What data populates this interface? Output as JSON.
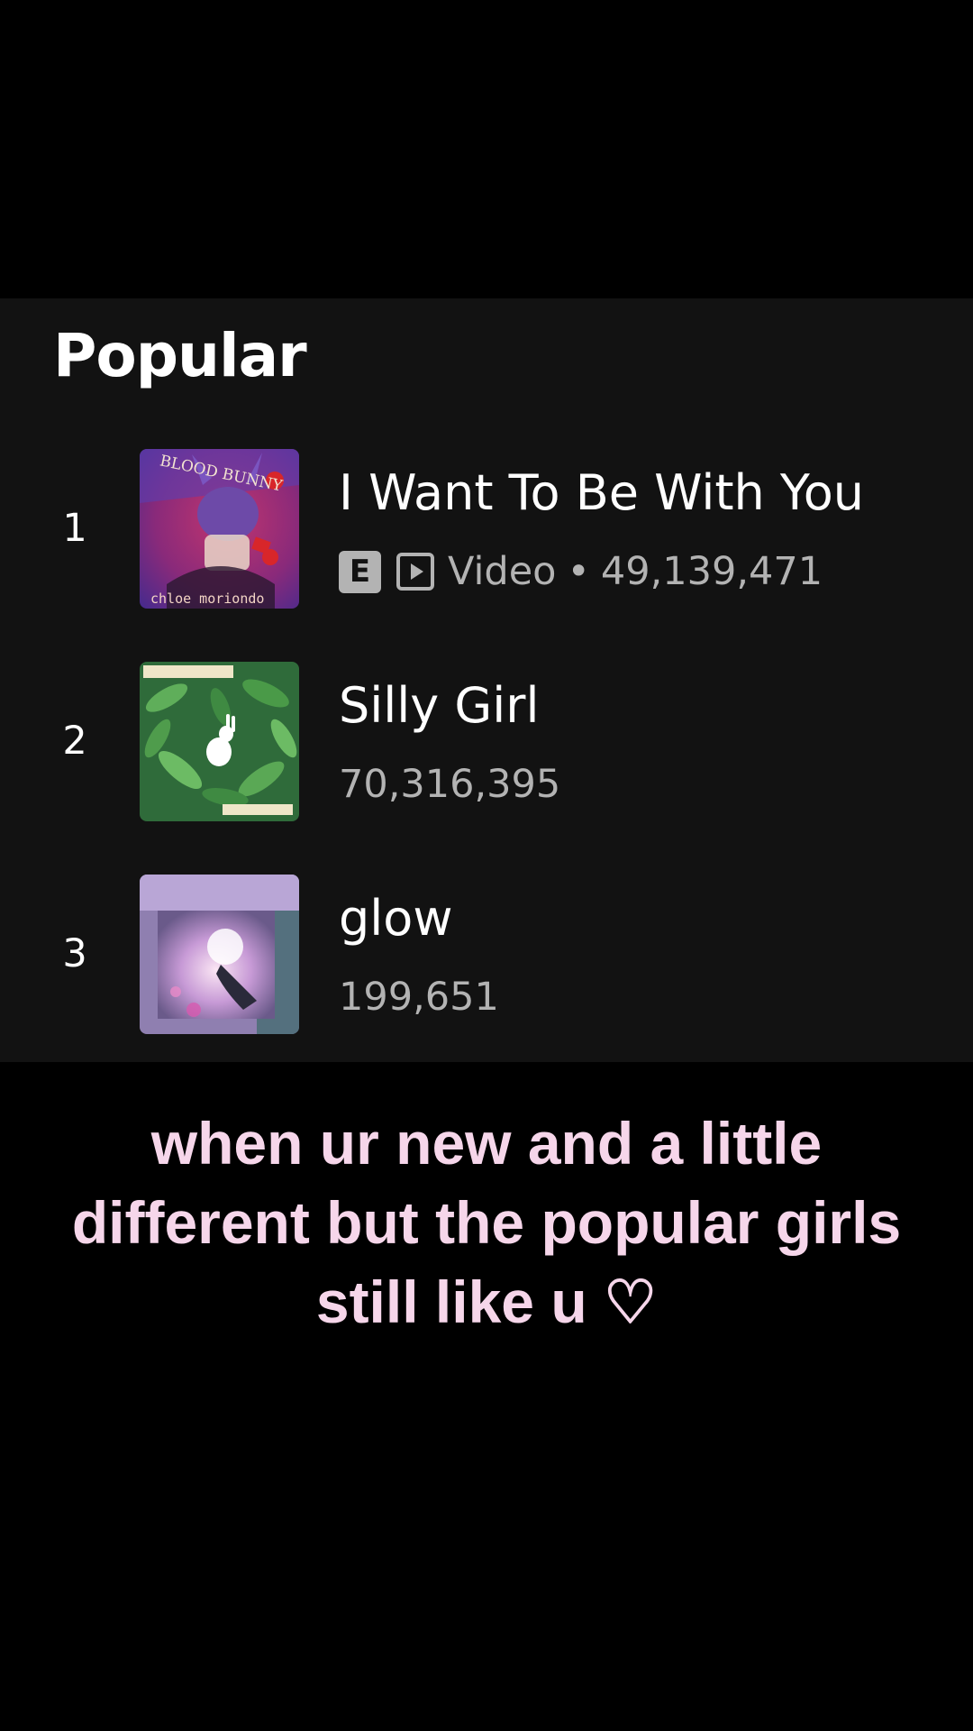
{
  "section": {
    "title": "Popular"
  },
  "tracks": [
    {
      "rank": "1",
      "title": "I Want To Be With You",
      "explicit_badge": "E",
      "video_icon": "play-video-icon",
      "meta_label": "Video",
      "separator": "•",
      "plays": "49,139,471",
      "cover": "album-cover-blood-bunny"
    },
    {
      "rank": "2",
      "title": "Silly Girl",
      "plays": "70,316,395",
      "cover": "album-cover-rabbit-hearted"
    },
    {
      "rank": "3",
      "title": "glow",
      "plays": "199,651",
      "cover": "album-cover-glow"
    }
  ],
  "caption": {
    "text": "when ur new and a little different but the popular girls still like u ♡"
  },
  "colors": {
    "page_bg": "#000000",
    "panel_bg": "#121212",
    "primary_text": "#ffffff",
    "secondary_text": "#b3b3b3",
    "caption_text": "#f6d6ea"
  }
}
